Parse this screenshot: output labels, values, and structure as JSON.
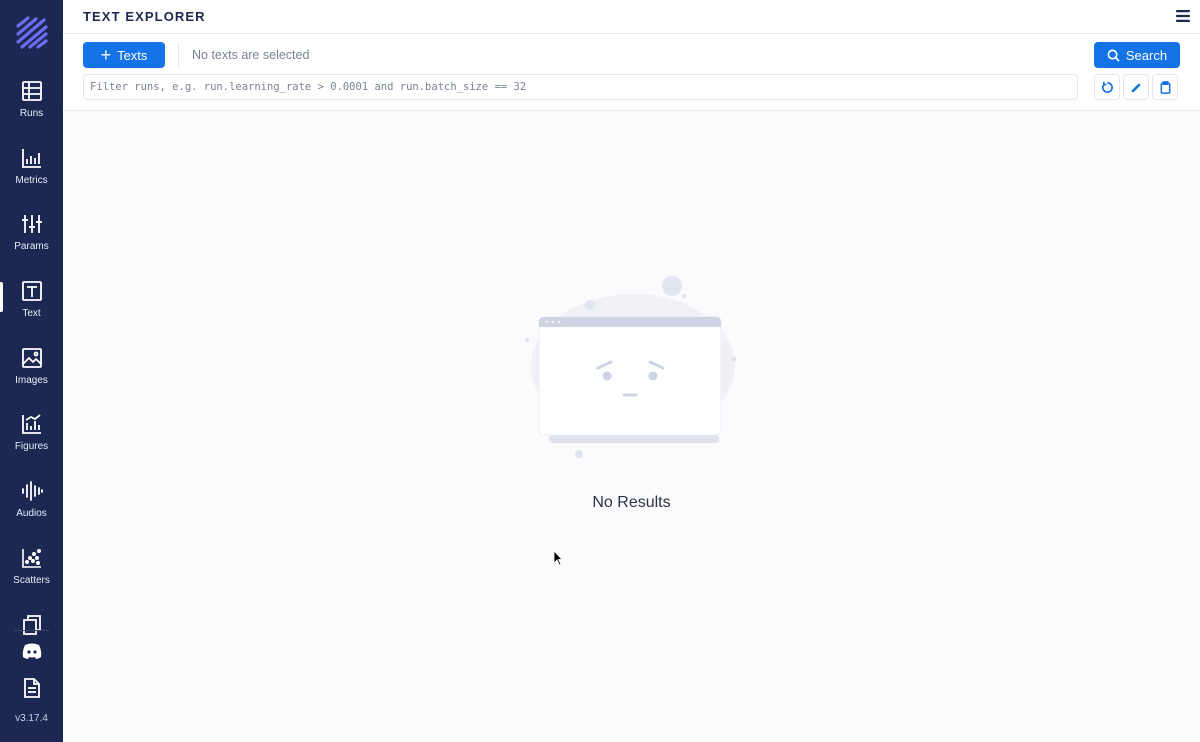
{
  "sidebar": {
    "items": [
      {
        "label": "Runs",
        "icon": "table-icon"
      },
      {
        "label": "Metrics",
        "icon": "bar-chart-icon"
      },
      {
        "label": "Params",
        "icon": "sliders-icon"
      },
      {
        "label": "Text",
        "icon": "text-icon",
        "active": true
      },
      {
        "label": "Images",
        "icon": "image-icon"
      },
      {
        "label": "Figures",
        "icon": "figures-icon"
      },
      {
        "label": "Audios",
        "icon": "audio-wave-icon"
      },
      {
        "label": "Scatters",
        "icon": "scatter-icon"
      }
    ],
    "extra_icons": [
      "copy-icon",
      "discord-icon",
      "docs-icon"
    ],
    "version": "v3.17.4"
  },
  "header": {
    "title": "TEXT EXPLORER"
  },
  "toolbar": {
    "add_button_label": "Texts",
    "selection_status": "No texts are selected",
    "search_button_label": "Search",
    "filter_placeholder": "Filter runs, e.g. run.learning_rate > 0.0001 and run.batch_size == 32",
    "filter_value": ""
  },
  "main": {
    "empty_message": "No Results"
  },
  "colors": {
    "sidebar_bg": "#1c2852",
    "accent": "#1473e6",
    "background": "#fbfbfd"
  }
}
